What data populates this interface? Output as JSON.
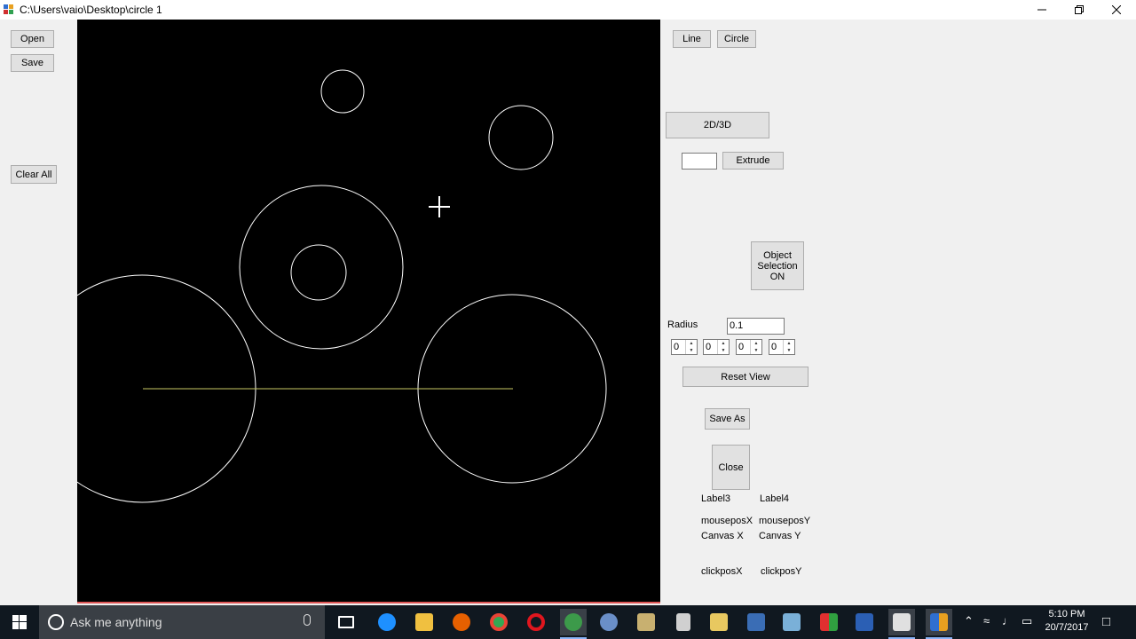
{
  "window": {
    "title": "C:\\Users\\vaio\\Desktop\\circle 1"
  },
  "left_panel": {
    "open_label": "Open",
    "save_label": "Save",
    "clear_all_label": "Clear All"
  },
  "right_panel": {
    "line_label": "Line",
    "circle_label": "Circle",
    "toggle_2d3d_label": "2D/3D",
    "extrude_value": "",
    "extrude_label": "Extrude",
    "object_selection_line1": "Object",
    "object_selection_line2": "Selection",
    "object_selection_line3": "ON",
    "radius_label": "Radius",
    "radius_value": "0.1",
    "steppers": [
      "0",
      "0",
      "0",
      "0"
    ],
    "reset_view_label": "Reset View",
    "save_as_label": "Save As",
    "close_label": "Close",
    "label3": "Label3",
    "label4": "Label4",
    "mouseposx": "mouseposX",
    "mouseposy": "mouseposY",
    "canvas_x": "Canvas X",
    "canvas_y": "Canvas Y",
    "clickposx": "clickposX",
    "clickposy": "clickposY"
  },
  "canvas": {
    "background": "#000000",
    "stroke_color": "#ffffff",
    "line_color": "#c8c864"
  },
  "taskbar": {
    "search_placeholder": "Ask me anything",
    "time": "5:10 PM",
    "date": "20/7/2017",
    "icons": [
      "task-view-icon",
      "edge-icon",
      "file-explorer-icon",
      "firefox-icon",
      "chrome-icon",
      "opera-icon",
      "globe-app-icon",
      "network-app-icon",
      "folder-app-icon",
      "calculator-icon",
      "paint-icon",
      "visual-studio-icon",
      "notepad-icon",
      "office-icon",
      "word-icon",
      "media-app-icon",
      "running-app-icon"
    ]
  }
}
